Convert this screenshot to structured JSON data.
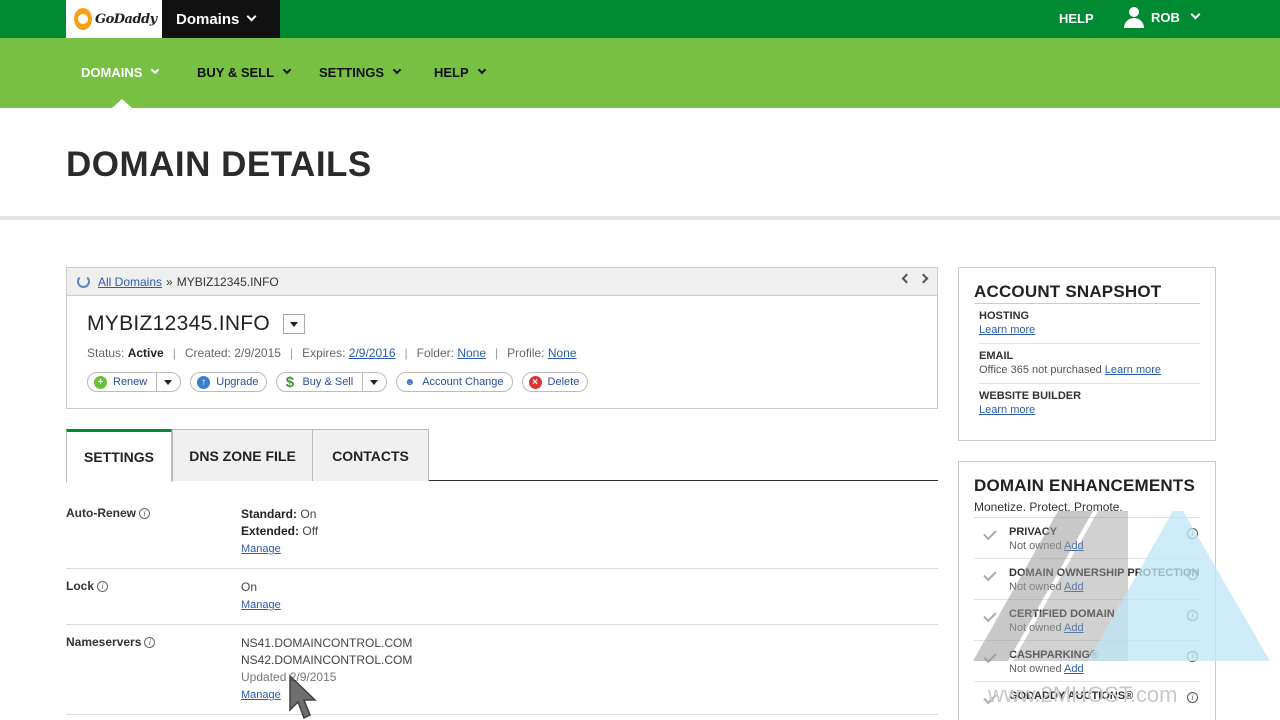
{
  "topbar": {
    "logo_text": "GoDaddy",
    "product_label": "Domains",
    "help_label": "HELP",
    "user_label": "ROB"
  },
  "nav": {
    "items": [
      {
        "label": "DOMAINS",
        "active": true
      },
      {
        "label": "BUY & SELL",
        "active": false
      },
      {
        "label": "SETTINGS",
        "active": false
      },
      {
        "label": "HELP",
        "active": false
      }
    ]
  },
  "page": {
    "title": "DOMAIN DETAILS"
  },
  "domain": {
    "breadcrumb_link": "All Domains",
    "breadcrumb_sep": "»",
    "breadcrumb_current": "MYBIZ12345.INFO",
    "name": "MYBIZ12345.INFO",
    "status_label": "Status:",
    "status_value": "Active",
    "created_label": "Created:",
    "created_value": "2/9/2015",
    "expires_label": "Expires:",
    "expires_value": "2/9/2016",
    "folder_label": "Folder:",
    "folder_value": "None",
    "profile_label": "Profile:",
    "profile_value": "None",
    "separator": "|",
    "actions": {
      "renew": "Renew",
      "upgrade": "Upgrade",
      "buy_sell": "Buy & Sell",
      "account_change": "Account Change",
      "delete": "Delete"
    }
  },
  "tabs": [
    {
      "label": "SETTINGS",
      "active": true
    },
    {
      "label": "DNS ZONE FILE",
      "active": false
    },
    {
      "label": "CONTACTS",
      "active": false
    }
  ],
  "settings": {
    "auto_renew": {
      "label": "Auto-Renew",
      "standard_label": "Standard:",
      "standard_value": "On",
      "extended_label": "Extended:",
      "extended_value": "Off",
      "manage": "Manage"
    },
    "lock": {
      "label": "Lock",
      "value": "On",
      "manage": "Manage"
    },
    "nameservers": {
      "label": "Nameservers",
      "ns1": "NS41.DOMAINCONTROL.COM",
      "ns2": "NS42.DOMAINCONTROL.COM",
      "updated": "Updated 2/9/2015",
      "manage": "Manage"
    }
  },
  "snapshot": {
    "title": "ACCOUNT SNAPSHOT",
    "hosting": {
      "label": "HOSTING",
      "link": "Learn more"
    },
    "email": {
      "label": "EMAIL",
      "desc": "Office 365 not purchased",
      "link": "Learn more"
    },
    "website_builder": {
      "label": "WEBSITE BUILDER",
      "link": "Learn more"
    }
  },
  "enhancements": {
    "title": "DOMAIN ENHANCEMENTS",
    "tagline": "Monetize. Protect. Promote.",
    "items": [
      {
        "label": "PRIVACY",
        "status": "Not owned",
        "link": "Add"
      },
      {
        "label": "DOMAIN OWNERSHIP PROTECTION",
        "status": "Not owned",
        "link": "Add"
      },
      {
        "label": "CERTIFIED DOMAIN",
        "status": "Not owned",
        "link": "Add"
      },
      {
        "label": "CASHPARKING®",
        "status": "Not owned",
        "link": "Add"
      },
      {
        "label": "GODADDY AUCTIONS®",
        "status": "",
        "link": ""
      }
    ]
  },
  "watermark": {
    "text": "www.2MHOST.com"
  },
  "colors": {
    "topbar": "#008a32",
    "nav": "#77c044",
    "product_bg": "#111111",
    "link": "#2a5db0"
  }
}
